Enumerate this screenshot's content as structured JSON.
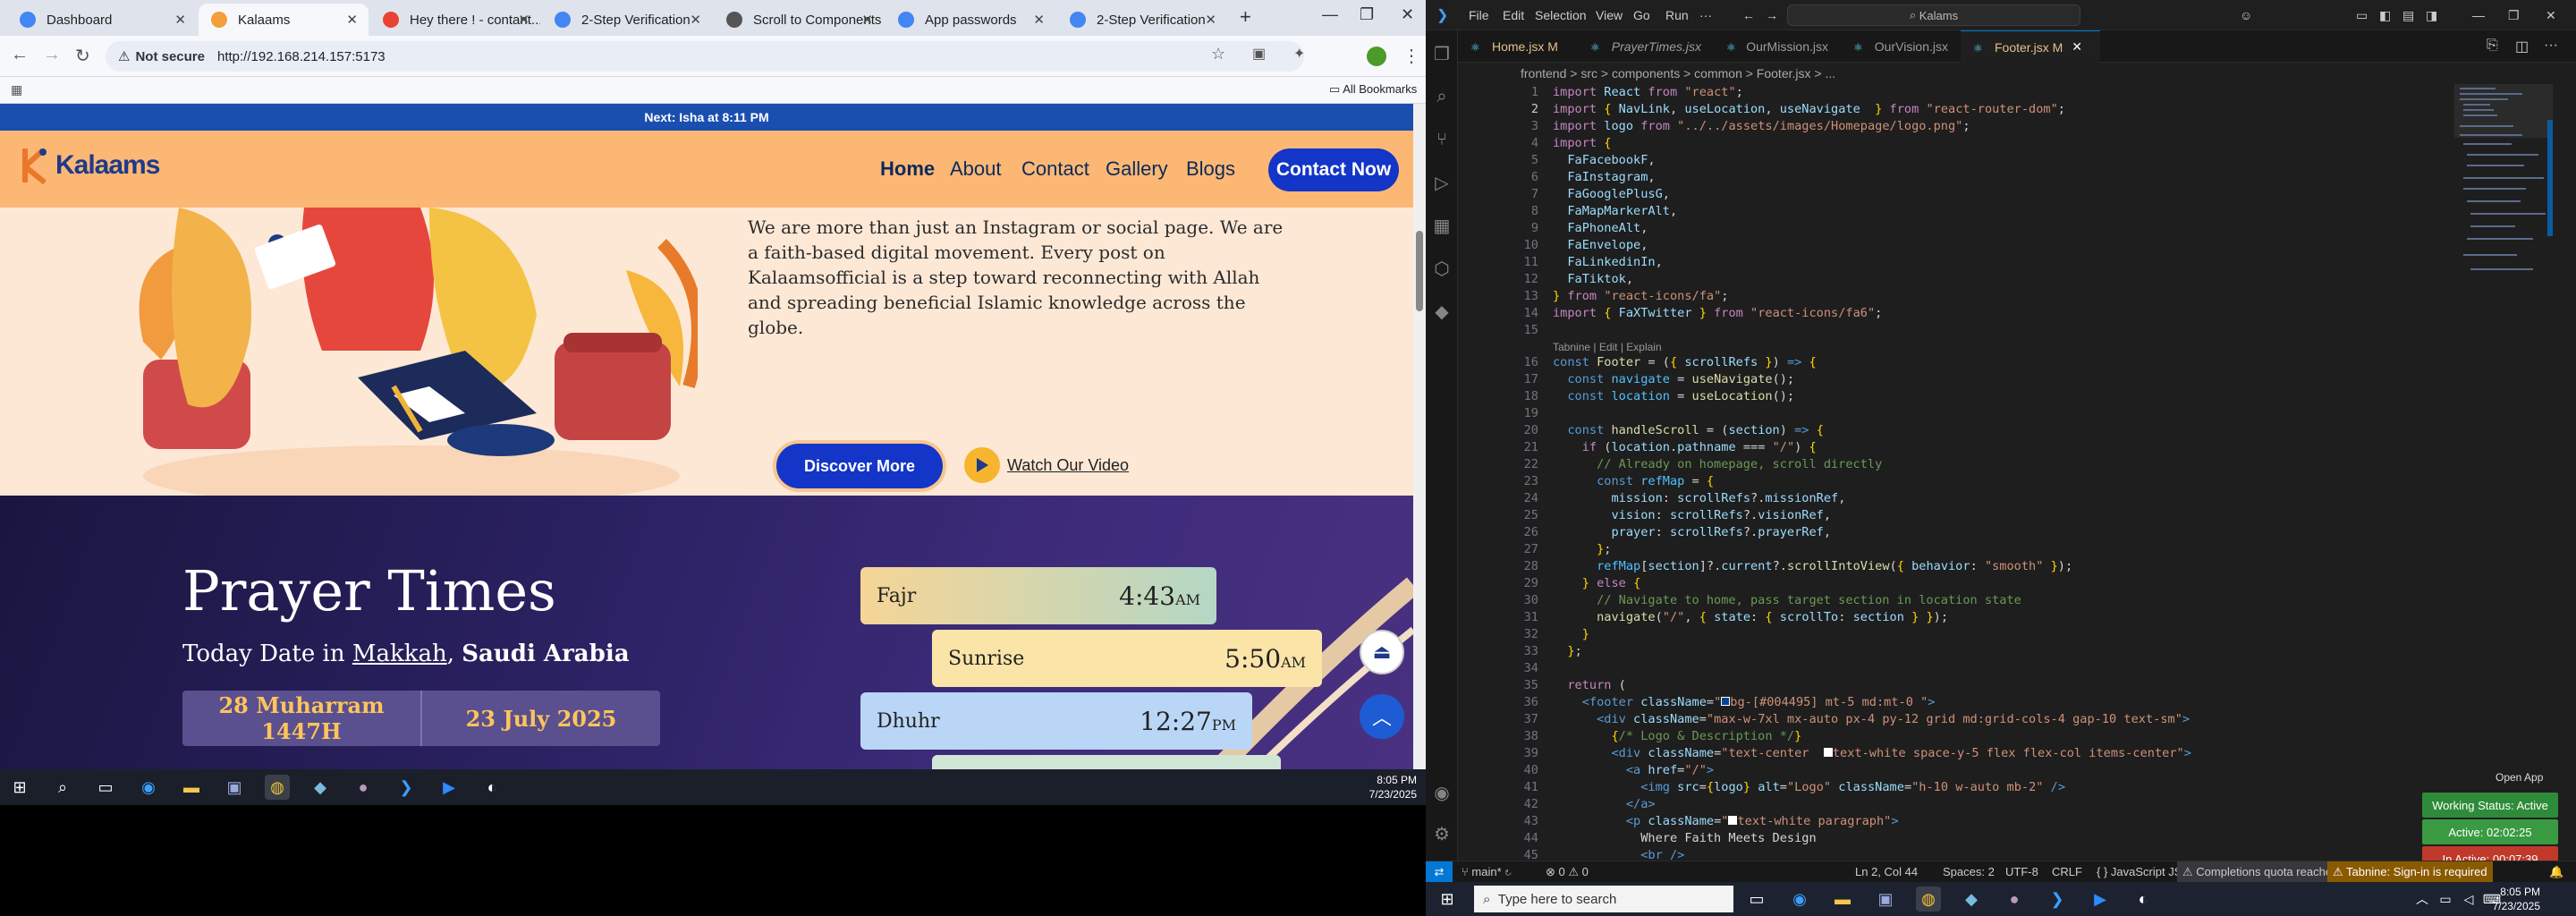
{
  "browser": {
    "tabs": [
      {
        "label": "Dashboard",
        "color": "#4285f4"
      },
      {
        "label": "Kalaams",
        "color": "#f59f3a"
      },
      {
        "label": "Hey there ! - contant...",
        "color": "#ea4335"
      },
      {
        "label": "2-Step Verification",
        "color": "#4285f4"
      },
      {
        "label": "Scroll to Components",
        "color": "#555555"
      },
      {
        "label": "App passwords",
        "color": "#4285f4"
      },
      {
        "label": "2-Step Verification",
        "color": "#4285f4"
      }
    ],
    "not_secure": "Not secure",
    "url": "http://192.168.214.157:5173",
    "all_bookmarks": "All Bookmarks"
  },
  "site": {
    "announcement": "Next: Isha at 8:11 PM",
    "logo_text": "Kalaams",
    "nav": [
      "Home",
      "About",
      "Contact",
      "Gallery",
      "Blogs"
    ],
    "contact_button": "Contact Now",
    "hero_paragraph": "We are more than just an Instagram or social page. We are a faith-based digital movement. Every post on Kalaamsofficial is a step toward reconnecting with Allah and spreading beneficial Islamic knowledge across the globe.",
    "discover_button": "Discover More",
    "watch_video": "Watch Our Video",
    "prayer_title": "Prayer Times",
    "today_prefix": "Today Date in",
    "city": "Makkah",
    "country": "Saudi Arabia",
    "hijri_date": "28 Muharram 1447H",
    "gregorian_date": "23 July 2025",
    "prayers": [
      {
        "name": "Fajr",
        "time": "4:43",
        "ampm": "AM"
      },
      {
        "name": "Sunrise",
        "time": "5:50",
        "ampm": "AM"
      },
      {
        "name": "Dhuhr",
        "time": "12:27",
        "ampm": "PM"
      }
    ]
  },
  "left_taskbar": {
    "time": "8:05 PM",
    "date": "7/23/2025"
  },
  "vscode": {
    "menus": [
      "File",
      "Edit",
      "Selection",
      "View",
      "Go",
      "Run"
    ],
    "search": "Kalams",
    "tabs": [
      {
        "label": "Home.jsx M"
      },
      {
        "label": "PrayerTimes.jsx"
      },
      {
        "label": "OurMission.jsx"
      },
      {
        "label": "OurVision.jsx"
      },
      {
        "label": "Footer.jsx M"
      }
    ],
    "breadcrumb": "frontend > src > components > common > Footer.jsx > ...",
    "codelens": "Tabnine | Edit | Explain",
    "status": {
      "branch": "main*",
      "problems": "0 ⚠ 0",
      "position": "Ln 2, Col 44",
      "spaces": "Spaces: 2",
      "encoding": "UTF-8",
      "eol": "CRLF",
      "language": "JavaScript JSX",
      "quota": "Completions quota reached",
      "tabnine": "Tabnine: Sign-in is required"
    },
    "badges": {
      "open_app": "Open App",
      "working_status": "Working Status: Active",
      "active": "Active: 02:02:25",
      "inactive": "In Active: 00:07:39"
    }
  },
  "right_taskbar": {
    "search_placeholder": "Type here to search",
    "time": "8:05 PM",
    "date": "7/23/2025"
  }
}
